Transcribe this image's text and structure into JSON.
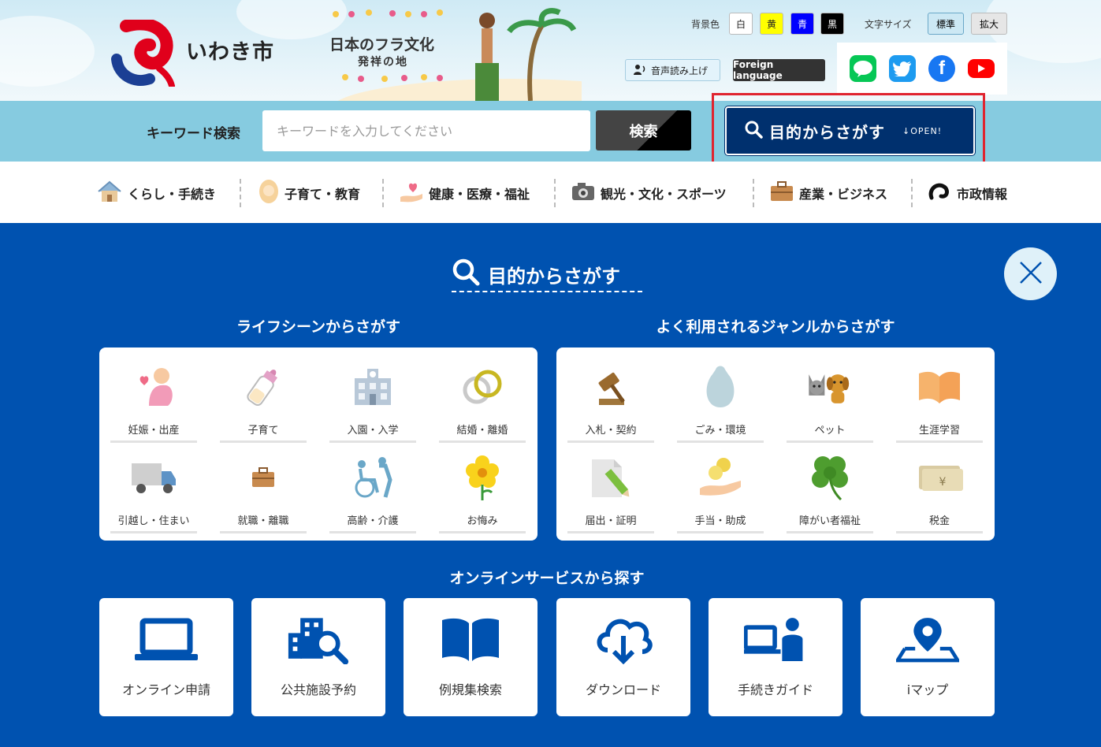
{
  "header": {
    "logo_text": "いわき市",
    "banner_line1": "日本のフラ文化",
    "banner_line2": "発祥の地",
    "bg_color_label": "背景色",
    "bg_colors": [
      {
        "label": "白",
        "color": "#ffffff",
        "text": "#222222"
      },
      {
        "label": "黄",
        "color": "#ffff00",
        "text": "#222222"
      },
      {
        "label": "青",
        "color": "#0000ff",
        "text": "#ffffff"
      },
      {
        "label": "黒",
        "color": "#000000",
        "text": "#ffffff"
      }
    ],
    "font_size_label": "文字サイズ",
    "font_sizes": [
      "標準",
      "拡大"
    ],
    "voice_button": "音声読み上げ",
    "foreign_button": "Foreign language",
    "sns": [
      {
        "name": "line-icon",
        "color": "#06c755",
        "text": "LINE"
      },
      {
        "name": "twitter-icon",
        "color": "#1d9bf0",
        "text": ""
      },
      {
        "name": "facebook-icon",
        "color": "#1877f2",
        "text": "f"
      },
      {
        "name": "youtube-icon",
        "color": "#ff0000",
        "text": ""
      }
    ]
  },
  "search": {
    "label": "キーワード検索",
    "placeholder": "キーワードを入力してください",
    "submit": "検索",
    "purpose_button": "目的からさがす",
    "purpose_open": "OPEN!"
  },
  "categories": [
    {
      "label": "くらし・手続き",
      "icon": "house-icon"
    },
    {
      "label": "子育て・教育",
      "icon": "baby-icon"
    },
    {
      "label": "健康・医療・福祉",
      "icon": "heart-hand-icon"
    },
    {
      "label": "観光・文化・スポーツ",
      "icon": "camera-icon"
    },
    {
      "label": "産業・ビジネス",
      "icon": "briefcase-icon"
    },
    {
      "label": "市政情報",
      "icon": "city-logo-icon"
    }
  ],
  "panel": {
    "title": "目的からさがす",
    "life_title": "ライフシーンからさがす",
    "life_items": [
      {
        "label": "妊娠・出産",
        "icon": "pregnancy-icon"
      },
      {
        "label": "子育て",
        "icon": "baby-bottle-icon"
      },
      {
        "label": "入園・入学",
        "icon": "school-icon"
      },
      {
        "label": "結婚・離婚",
        "icon": "rings-icon"
      },
      {
        "label": "引越し・住まい",
        "icon": "truck-icon"
      },
      {
        "label": "就職・離職",
        "icon": "briefcase-icon"
      },
      {
        "label": "高齢・介護",
        "icon": "wheelchair-icon"
      },
      {
        "label": "お悔み",
        "icon": "flower-icon"
      }
    ],
    "genre_title": "よく利用されるジャンルからさがす",
    "genre_items": [
      {
        "label": "入札・契約",
        "icon": "gavel-icon"
      },
      {
        "label": "ごみ・環境",
        "icon": "garbage-bag-icon"
      },
      {
        "label": "ペット",
        "icon": "pets-icon"
      },
      {
        "label": "生涯学習",
        "icon": "book-icon"
      },
      {
        "label": "届出・証明",
        "icon": "document-pen-icon"
      },
      {
        "label": "手当・助成",
        "icon": "coin-hand-icon"
      },
      {
        "label": "障がい者福祉",
        "icon": "clover-icon"
      },
      {
        "label": "税金",
        "icon": "money-icon"
      }
    ],
    "online_title": "オンラインサービスから探す",
    "online_items": [
      {
        "label": "オンライン申請",
        "icon": "laptop-icon"
      },
      {
        "label": "公共施設予約",
        "icon": "building-search-icon"
      },
      {
        "label": "例規集検索",
        "icon": "open-book-icon"
      },
      {
        "label": "ダウンロード",
        "icon": "cloud-download-icon"
      },
      {
        "label": "手続きガイド",
        "icon": "person-computer-icon"
      },
      {
        "label": "iマップ",
        "icon": "map-pin-icon"
      }
    ]
  }
}
